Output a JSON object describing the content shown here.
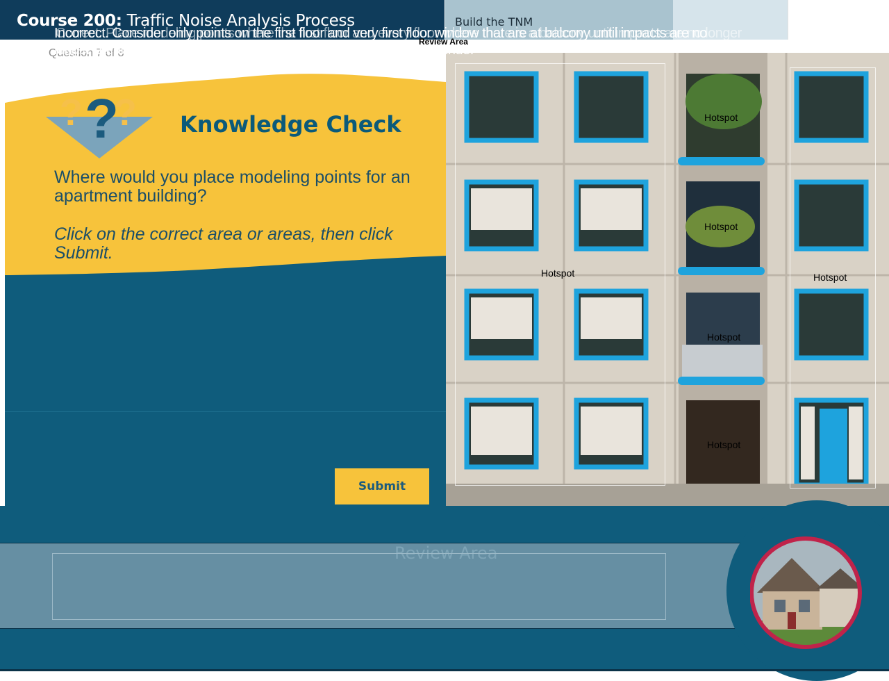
{
  "header": {
    "course_prefix": "Course 200:",
    "course_name": "Traffic Noise Analysis Process",
    "progress_segments": [
      "Build the TNM",
      "",
      ""
    ]
  },
  "question": {
    "counter": "Question 7 of 8",
    "title": "Knowledge Check",
    "prompt": "Where would you place modeling points for an apartment building?",
    "instruction": "Click on the correct area or areas, then click Submit.",
    "submit_label": "Submit"
  },
  "hotspots": [
    "Hotspot",
    "Hotspot",
    "Hotspot",
    "Hotspot",
    "Hotspot",
    "Hotspot"
  ],
  "review": {
    "title": "Review Area",
    "text_a": "Incorrect. Consider only points on the first floor and very first floor window that are at balcony until impacts are no longer predicted. Click anywhere or click the Forward button to continue.",
    "text_b": "Correct. Place modeling points where the first floor and every floor where there is a balcony until impacts are no longer predicted. Click anywhere or click the Forward button to continue.",
    "tag": "Review Area"
  },
  "colors": {
    "navy": "#0f3c5b",
    "teal": "#0f5c7c",
    "yellow": "#f7c33b"
  }
}
